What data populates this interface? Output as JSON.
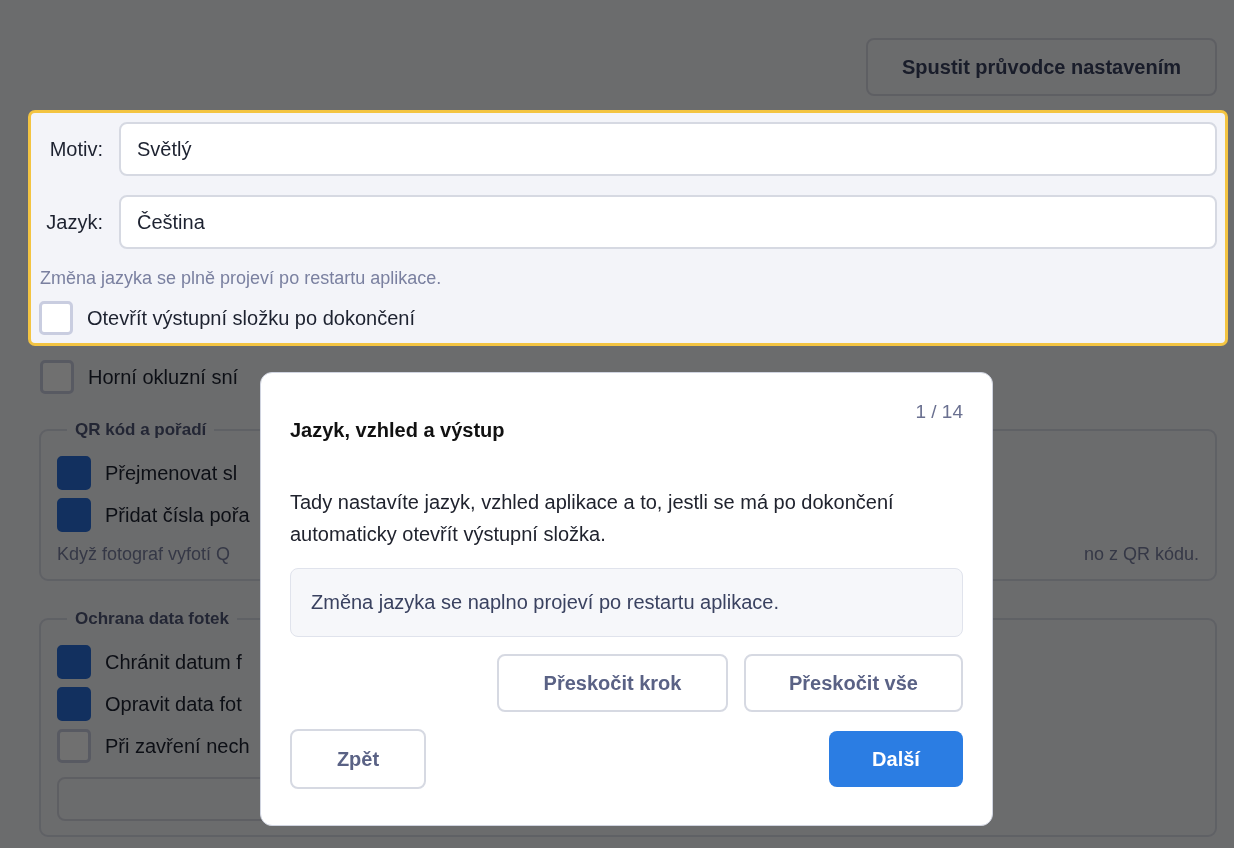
{
  "header": {
    "wizard_button": "Spustit průvodce nastavením"
  },
  "highlighted_section": {
    "fields": [
      {
        "label": "Motiv:",
        "value": "Světlý"
      },
      {
        "label": "Jazyk:",
        "value": "Čeština"
      }
    ],
    "hint": "Změna jazyka se plně projeví po restartu aplikace.",
    "checkbox": {
      "label": "Otevřít výstupní složku po dokončení",
      "checked": false
    }
  },
  "checkboxes": [
    {
      "label": "Horní okluzní sní",
      "checked": false
    }
  ],
  "groups": [
    {
      "title": "QR kód a pořadí",
      "items": [
        {
          "kind": "checkbox",
          "label": "Přejmenovat sl",
          "checked": true
        },
        {
          "kind": "checkbox",
          "label": "Přidat čísla pořa",
          "checked": true
        }
      ],
      "hint_left": "Když fotograf vyfotí Q",
      "hint_right": "no z QR kódu."
    },
    {
      "title": "Ochrana data fotek",
      "items": [
        {
          "kind": "checkbox",
          "label": "Chránit datum f",
          "checked": true
        },
        {
          "kind": "checkbox",
          "label": "Opravit data fot",
          "checked": true
        },
        {
          "kind": "checkbox",
          "label": "Při zavření nech",
          "checked": false
        },
        {
          "kind": "button"
        }
      ]
    }
  ],
  "tour": {
    "counter": "1 / 14",
    "title": "Jazyk, vzhled a výstup",
    "body": "Tady nastavíte jazyk, vzhled aplikace a to, jestli se má po dokončení automaticky otevřít výstupní složka.",
    "note": "Změna jazyka se naplno projeví po restartu aplikace.",
    "skip_buttons": [
      "Přeskočit krok",
      "Přeskočit vše"
    ],
    "back": "Zpět",
    "next": "Další"
  }
}
